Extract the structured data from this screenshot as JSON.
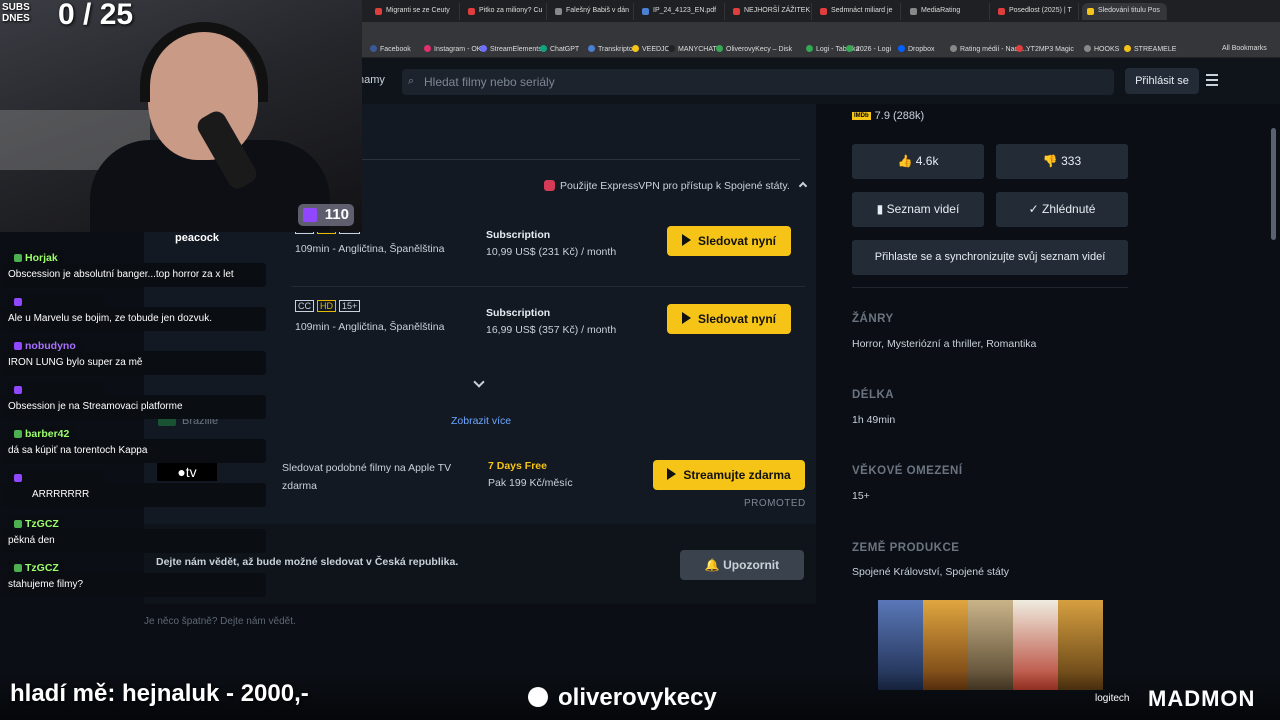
{
  "browser": {
    "tabs": [
      {
        "label": "Migranti se ze Ceuty",
        "color": "#e03d3d"
      },
      {
        "label": "Pitko za miliony? Cu",
        "color": "#e03d3d"
      },
      {
        "label": "Falešný Babiš v dán",
        "color": "#888888"
      },
      {
        "label": "IP_24_4123_EN.pdf",
        "color": "#4a7fd1"
      },
      {
        "label": "NEJHORŠÍ ZÁŽITEK",
        "color": "#e03d3d"
      },
      {
        "label": "Sedmnáct miliard je",
        "color": "#e03d3d"
      },
      {
        "label": "MediaRating",
        "color": "#888888"
      },
      {
        "label": "Posedlost (2025) | T",
        "color": "#e03d3d"
      },
      {
        "label": "Sledování titulu Pos",
        "color": "#f6c416"
      }
    ],
    "bookmarks": [
      {
        "label": "Facebook",
        "color": "#3b5998"
      },
      {
        "label": "Instagram - OK",
        "color": "#e1306c"
      },
      {
        "label": "StreamElements",
        "color": "#6f6fff"
      },
      {
        "label": "ChatGPT",
        "color": "#10a37f"
      },
      {
        "label": "Transkriptor",
        "color": "#4a7fd1"
      },
      {
        "label": "VEEDJO",
        "color": "#f6c416"
      },
      {
        "label": "MANYCHAT",
        "color": "#222222"
      },
      {
        "label": "OliverovyKecy – Disk",
        "color": "#34a853"
      },
      {
        "label": "Logi - Tabulka",
        "color": "#34a853"
      },
      {
        "label": "2026 - Logi",
        "color": "#34a853"
      },
      {
        "label": "Dropbox",
        "color": "#0061ff"
      },
      {
        "label": "Rating médií - Nada...",
        "color": "#888888"
      },
      {
        "label": "YT2MP3 Magic",
        "color": "#e03d3d"
      },
      {
        "label": "HOOKS",
        "color": "#888888"
      },
      {
        "label": "STREAMELE",
        "color": "#f6c416"
      }
    ],
    "all_bookmarks": "All Bookmarks"
  },
  "header": {
    "partial_nav": "namy",
    "search_placeholder": "Hledat filmy nebo seriály",
    "login": "Přihlásit se"
  },
  "offers": {
    "vpn_notice": "Použijte ExpressVPN pro přístup k Spojené státy.",
    "rows": [
      {
        "badges": [
          "CC",
          "HD",
          "15+"
        ],
        "duration": "109min - Angličtina, Španělština",
        "plan": "Subscription",
        "price": "10,99 US$ (231 Kč) / month",
        "button": "Sledovat nyní"
      },
      {
        "badges": [
          "CC",
          "HD",
          "15+"
        ],
        "duration": "109min - Angličtina, Španělština",
        "plan": "Subscription",
        "price": "16,99 US$ (357 Kč) / month",
        "button": "Sledovat nyní"
      }
    ],
    "show_more": "Zobrazit více",
    "brazil": "Brazilie",
    "promo": {
      "logo": "tv",
      "text": "Sledovat podobné filmy na Apple TV zdarma",
      "title": "7 Days Free",
      "price": "Pak 199 Kč/měsíc",
      "button": "Streamujte zdarma",
      "tag": "PROMOTED"
    },
    "notify_text": "Dejte nám vědět, až bude možné sledovat v Česká republika.",
    "notify_button": "Upozornit",
    "report": "Je něco špatně? Dejte nám vědět."
  },
  "sidebar": {
    "imdb_label": "IMDb",
    "imdb": "7.9 (288k)",
    "likes": "4.6k",
    "dislikes": "333",
    "watchlist": "Seznam videí",
    "seen": "Zhlédnuté",
    "sync": "Přihlaste se a synchronizujte svůj seznam videí",
    "sections": [
      {
        "title": "ŽÁNRY",
        "value": "Horror, Mysteriózní a thriller, Romantika"
      },
      {
        "title": "DÉLKA",
        "value": "1h 49min"
      },
      {
        "title": "VĚKOVÉ OMEZENÍ",
        "value": "15+"
      },
      {
        "title": "ZEMĚ PRODUKCE",
        "value": "Spojené Království, Spojené státy"
      }
    ]
  },
  "stream": {
    "subs_label": "SUBS DNES",
    "subs_count": "0 / 25",
    "viewers": "110",
    "peacock": "peacock",
    "chat": [
      {
        "user": "Horjak",
        "color": "#9cff6a",
        "msg": "Obscession je absolutní banger...top horror za x let"
      },
      {
        "user": "",
        "color": "#9146ff",
        "msg": "Ale u Marvelu se bojim, ze tobude jen dozvuk."
      },
      {
        "user": "nobudyno",
        "color": "#a970ff",
        "msg": "IRON LUNG bylo super za mě"
      },
      {
        "user": "",
        "color": "#9146ff",
        "msg": "Obsession je na Streamovaci platforme"
      },
      {
        "user": "barber42",
        "color": "#9cff6a",
        "msg": "dá sa kúpiť na torentoch Kappa"
      },
      {
        "user": "",
        "color": "#9146ff",
        "msg": "ARRRRRRR"
      },
      {
        "user": "TzGCZ",
        "color": "#9cff6a",
        "msg": "pěkná den"
      },
      {
        "user": "TzGCZ",
        "color": "#9cff6a",
        "msg": "stahujeme filmy?"
      }
    ],
    "ticker": "hladí mě: hejnaluk - 2000,-",
    "channel": "oliverovykecy",
    "sponsor": "logitech",
    "brand": "MADMON"
  }
}
